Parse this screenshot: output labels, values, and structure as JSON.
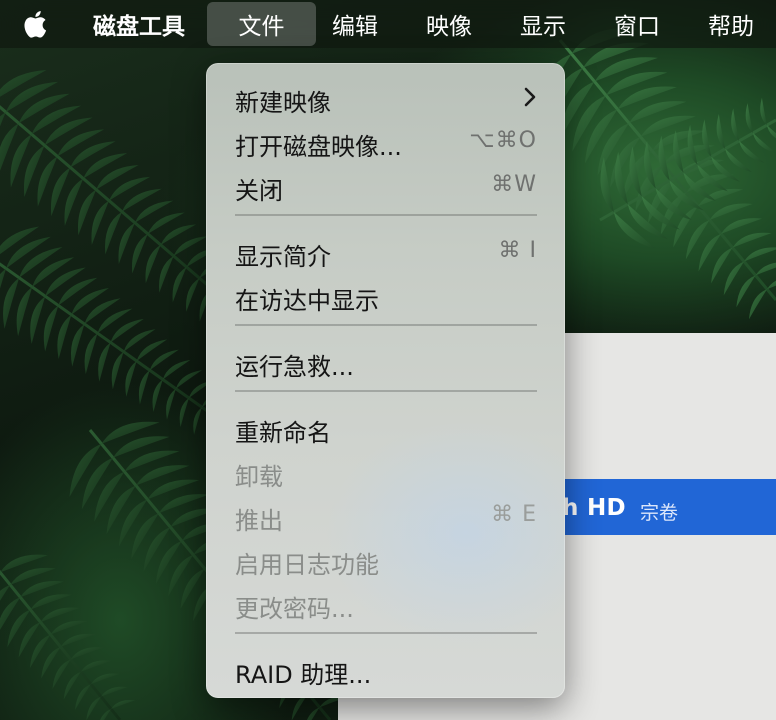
{
  "menubar": {
    "apple_icon": "apple-logo-icon",
    "app_name": "磁盘工具",
    "menus": [
      "文件",
      "编辑",
      "映像",
      "显示",
      "窗口",
      "帮助"
    ],
    "active_menu": "文件"
  },
  "file_menu": {
    "items": [
      {
        "label": "新建映像",
        "shortcut": "",
        "submenu": true,
        "enabled": true
      },
      {
        "label": "打开磁盘映像...",
        "shortcut": "⌥⌘O",
        "submenu": false,
        "enabled": true
      },
      {
        "label": "关闭",
        "shortcut": "⌘W",
        "submenu": false,
        "enabled": true
      },
      {
        "label": "显示简介",
        "shortcut": "⌘ I",
        "submenu": false,
        "enabled": true
      },
      {
        "label": "在访达中显示",
        "shortcut": "",
        "submenu": false,
        "enabled": true
      },
      {
        "label": "运行急救...",
        "shortcut": "",
        "submenu": false,
        "enabled": true
      },
      {
        "label": "重新命名",
        "shortcut": "",
        "submenu": false,
        "enabled": true
      },
      {
        "label": "卸载",
        "shortcut": "",
        "submenu": false,
        "enabled": false
      },
      {
        "label": "推出",
        "shortcut": "⌘ E",
        "submenu": false,
        "enabled": false
      },
      {
        "label": "启用日志功能",
        "shortcut": "",
        "submenu": false,
        "enabled": false
      },
      {
        "label": "更改密码...",
        "shortcut": "",
        "submenu": false,
        "enabled": false
      },
      {
        "label": "RAID 助理...",
        "shortcut": "",
        "submenu": false,
        "enabled": true
      }
    ]
  },
  "background_window": {
    "selected_volume_name": "h HD",
    "selected_volume_kind": "宗卷"
  },
  "colors": {
    "selection_blue": "#2166d6",
    "menu_text": "#151515",
    "menu_disabled_text": "#8a8d8a"
  }
}
